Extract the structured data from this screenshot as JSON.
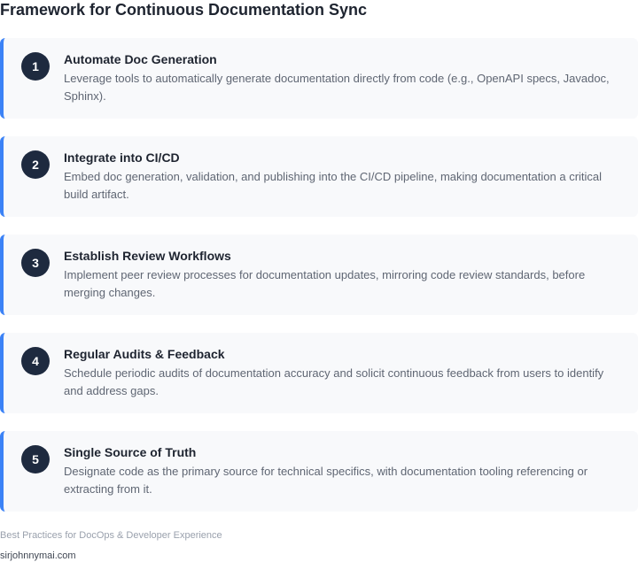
{
  "title": "Framework for Continuous Documentation Sync",
  "steps": [
    {
      "number": "1",
      "title": "Automate Doc Generation",
      "description": "Leverage tools to automatically generate documentation directly from code (e.g., OpenAPI specs, Javadoc, Sphinx)."
    },
    {
      "number": "2",
      "title": "Integrate into CI/CD",
      "description": "Embed doc generation, validation, and publishing into the CI/CD pipeline, making documentation a critical build artifact."
    },
    {
      "number": "3",
      "title": "Establish Review Workflows",
      "description": "Implement peer review processes for documentation updates, mirroring code review standards, before merging changes."
    },
    {
      "number": "4",
      "title": "Regular Audits & Feedback",
      "description": "Schedule periodic audits of documentation accuracy and solicit continuous feedback from users to identify and address gaps."
    },
    {
      "number": "5",
      "title": "Single Source of Truth",
      "description": "Designate code as the primary source for technical specifics, with documentation tooling referencing or extracting from it."
    }
  ],
  "footer": {
    "caption": "Best Practices for DocOps & Developer Experience",
    "site": "sirjohnnymai.com"
  },
  "colors": {
    "accent": "#3b82f6",
    "badge": "#1e2a3f",
    "card_background": "#f8f9fb"
  }
}
